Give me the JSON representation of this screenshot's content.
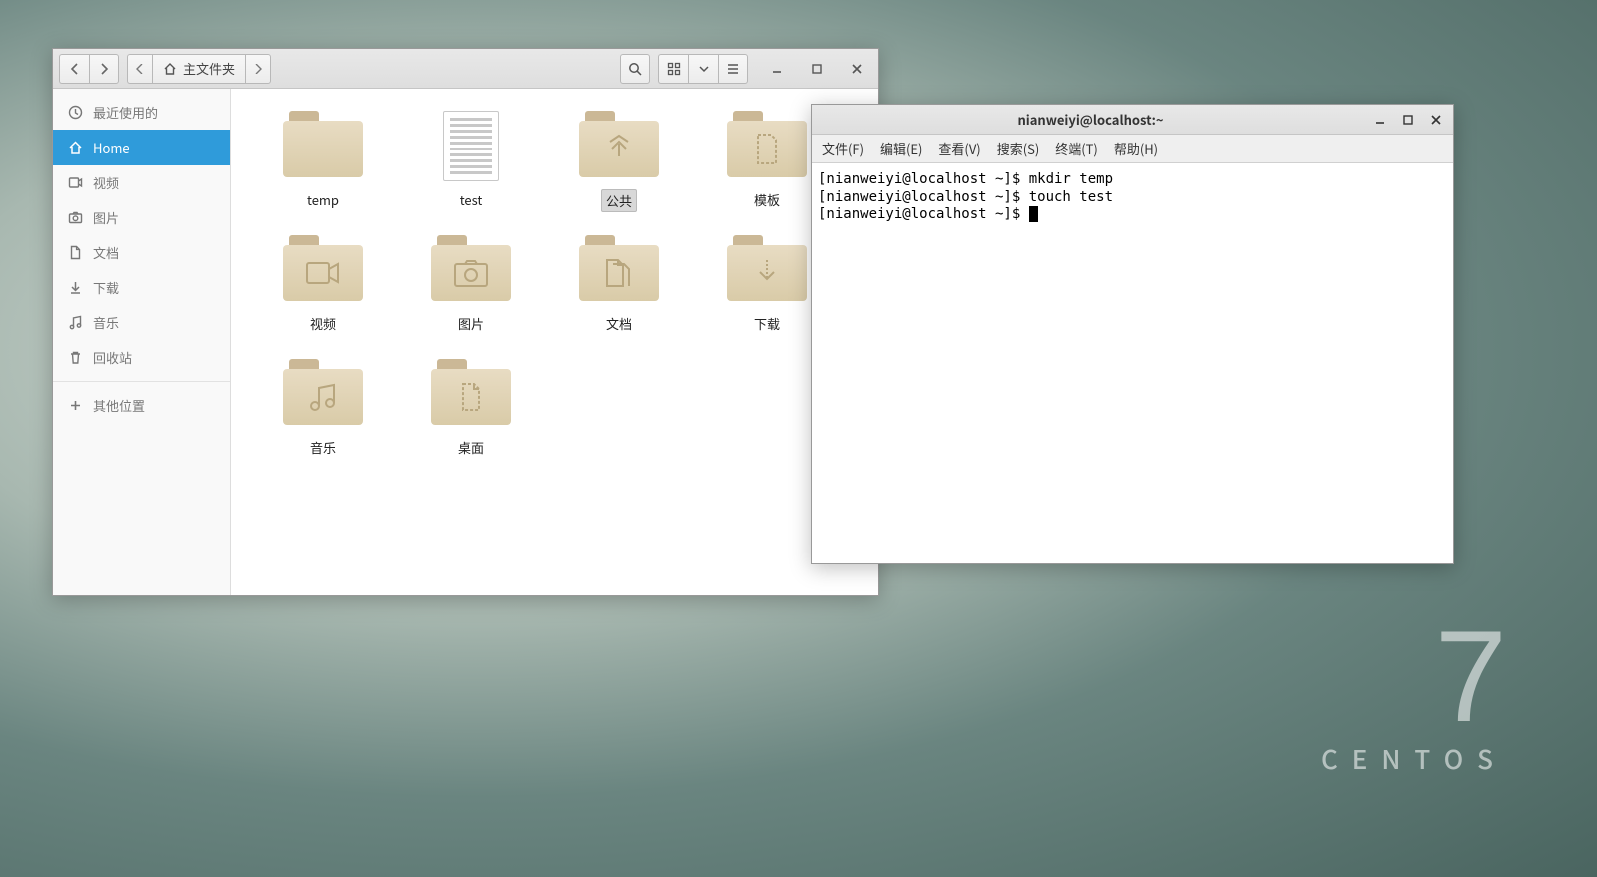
{
  "desktop": {
    "brand_name": "CENTOS",
    "brand_version": "7"
  },
  "fm": {
    "path_label": "主文件夹",
    "sidebar": [
      {
        "icon": "clock",
        "label": "最近使用的",
        "active": false
      },
      {
        "icon": "home",
        "label": "Home",
        "active": true
      },
      {
        "icon": "video",
        "label": "视频",
        "active": false
      },
      {
        "icon": "camera",
        "label": "图片",
        "active": false
      },
      {
        "icon": "doc",
        "label": "文档",
        "active": false
      },
      {
        "icon": "down",
        "label": "下载",
        "active": false
      },
      {
        "icon": "music",
        "label": "音乐",
        "active": false
      },
      {
        "icon": "trash",
        "label": "回收站",
        "active": false
      },
      {
        "icon": "plus",
        "label": "其他位置",
        "active": false
      }
    ],
    "items": [
      {
        "type": "folder",
        "glyph": "",
        "label": "temp",
        "selected": false
      },
      {
        "type": "file",
        "glyph": "",
        "label": "test",
        "selected": false
      },
      {
        "type": "folder",
        "glyph": "share",
        "label": "公共",
        "selected": true
      },
      {
        "type": "folder",
        "glyph": "template",
        "label": "模板",
        "selected": false
      },
      {
        "type": "folder",
        "glyph": "video",
        "label": "视频",
        "selected": false
      },
      {
        "type": "folder",
        "glyph": "camera",
        "label": "图片",
        "selected": false
      },
      {
        "type": "folder",
        "glyph": "doc",
        "label": "文档",
        "selected": false
      },
      {
        "type": "folder",
        "glyph": "down",
        "label": "下载",
        "selected": false
      },
      {
        "type": "folder",
        "glyph": "music",
        "label": "音乐",
        "selected": false
      },
      {
        "type": "folder",
        "glyph": "desktop",
        "label": "桌面",
        "selected": false
      }
    ]
  },
  "terminal": {
    "title": "nianweiyi@localhost:~",
    "menu": [
      "文件(F)",
      "编辑(E)",
      "查看(V)",
      "搜索(S)",
      "终端(T)",
      "帮助(H)"
    ],
    "lines": [
      {
        "prompt": "[nianweiyi@localhost ~]$ ",
        "cmd": "mkdir temp"
      },
      {
        "prompt": "[nianweiyi@localhost ~]$ ",
        "cmd": "touch test"
      },
      {
        "prompt": "[nianweiyi@localhost ~]$ ",
        "cmd": ""
      }
    ]
  }
}
